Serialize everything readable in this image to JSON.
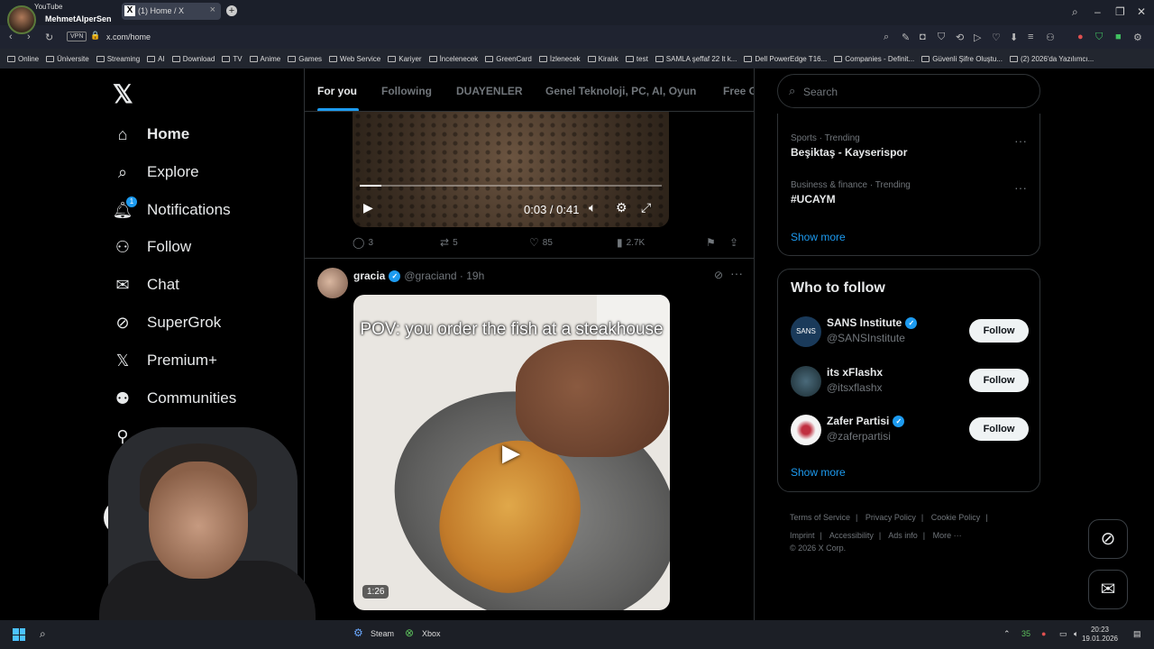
{
  "browser": {
    "profile_top": "YouTube",
    "profile_name": "MehmetAlperSen",
    "tab_title": "(1) Home / X",
    "url": "x.com/home",
    "vpn_label": "VPN",
    "bookmarks": [
      "Online",
      "Üniversite",
      "Streaming",
      "AI",
      "Download",
      "TV",
      "Anime",
      "Games",
      "Web Service",
      "Kariyer",
      "İncelenecek",
      "GreenCard",
      "İzlenecek",
      "Kiralık",
      "test",
      "SAMLA şeffaf 22 lt k...",
      "Dell PowerEdge T16...",
      "Companies - Definit...",
      "Güvenli Şifre Oluştu...",
      "(2) 2026'da Yazılımcı..."
    ]
  },
  "sidebar": {
    "items": [
      {
        "label": "Home",
        "icon": "home-icon"
      },
      {
        "label": "Explore",
        "icon": "search-icon"
      },
      {
        "label": "Notifications",
        "icon": "bell-icon",
        "badge": "1"
      },
      {
        "label": "Follow",
        "icon": "person-add-icon"
      },
      {
        "label": "Chat",
        "icon": "mail-icon"
      },
      {
        "label": "SuperGrok",
        "icon": "grok-icon"
      },
      {
        "label": "Premium+",
        "icon": "x-icon"
      },
      {
        "label": "Communities",
        "icon": "people-icon"
      },
      {
        "label": "Pr",
        "icon": "profile-icon"
      }
    ]
  },
  "feed": {
    "tabs": [
      "For you",
      "Following",
      "DUAYENLER",
      "Genel Teknoloji, PC, AI, Oyun",
      "Free G"
    ],
    "post1": {
      "time": "0:03 / 0:41",
      "progress": 0.073,
      "replies": "3",
      "reposts": "5",
      "likes": "85",
      "views": "2.7K"
    },
    "post2": {
      "name": "gracia",
      "handle": "@graciand · 19h",
      "caption": "POV: you order the fish at a steakhouse",
      "duration": "1:26"
    }
  },
  "right": {
    "search_placeholder": "Search",
    "trends": [
      {
        "meta": "Sports · Trending",
        "name": "Beşiktaş - Kayserispor"
      },
      {
        "meta": "Business & finance · Trending",
        "name": "#UCAYM"
      }
    ],
    "show_more": "Show more",
    "wtf_title": "Who to follow",
    "who_to_follow": [
      {
        "name": "SANS Institute",
        "handle": "@SANSInstitute",
        "verified": true,
        "button": "Follow"
      },
      {
        "name": "its xFlashx",
        "handle": "@itsxflashx",
        "verified": false,
        "button": "Follow"
      },
      {
        "name": "Zafer Partisi",
        "handle": "@zaferpartisi",
        "verified": true,
        "button": "Follow"
      }
    ],
    "wtf_show_more": "Show more",
    "footer": [
      "Terms of Service",
      "|",
      "Privacy Policy",
      "|",
      "Cookie Policy",
      "|",
      "Imprint",
      "|",
      "Accessibility",
      "|",
      "Ads info",
      "|",
      "More ···",
      "© 2026 X Corp."
    ]
  },
  "taskbar": {
    "steam": "Steam",
    "xbox": "Xbox",
    "time": "20:23",
    "date": "19.01.2026",
    "tray_num": "35"
  },
  "colors": {
    "accent": "#1d9bf0",
    "background": "#000000",
    "muted": "#71767b"
  }
}
